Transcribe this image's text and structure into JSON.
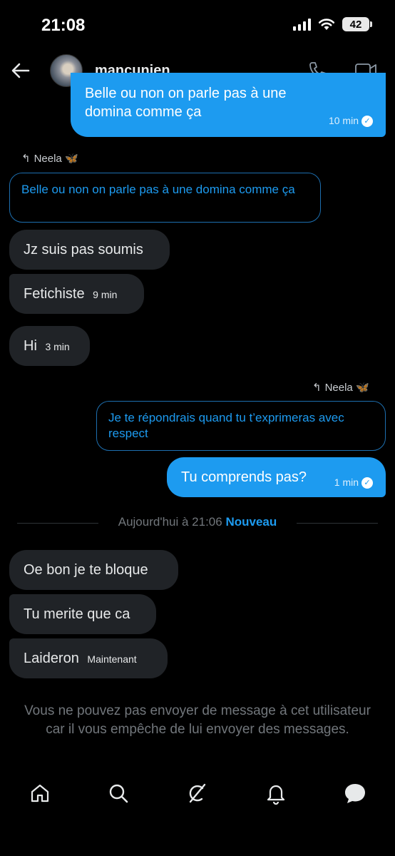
{
  "status": {
    "time": "21:08",
    "battery": "42"
  },
  "header": {
    "username": "mancunien"
  },
  "messages": {
    "top_sent": {
      "text": "Belle ou non on parle pas à une domina comme ça",
      "time": "10 min"
    },
    "reply1": {
      "label": "Neela 🦋",
      "quote": "Belle ou non on parle pas à une domina comme ça"
    },
    "recv1": {
      "text": "Jz suis pas soumis"
    },
    "recv2": {
      "text": "Fetichiste",
      "time": "9 min"
    },
    "recv3": {
      "text": "Hi",
      "time": "3 min"
    },
    "reply2": {
      "label": "Neela 🦋",
      "quote": "Je te répondrais quand tu t’exprimeras avec respect"
    },
    "sent2": {
      "text": "Tu comprends pas?",
      "time": "1 min"
    },
    "divider": {
      "text": "Aujourd'hui à 21:06",
      "new_label": "Nouveau"
    },
    "recv4": {
      "text": "Oe bon je te bloque"
    },
    "recv5": {
      "text": "Tu merite que ca"
    },
    "recv6": {
      "text": "Laideron",
      "time": "Maintenant"
    }
  },
  "blocked_notice": "Vous ne pouvez pas envoyer de message à cet utilisateur car il vous empêche de lui envoyer des messages.",
  "nav": [
    "home-icon",
    "search-icon",
    "grok-icon",
    "notifications-icon",
    "messages-icon"
  ],
  "colors": {
    "accent": "#1d9bf0",
    "received_bubble": "#202327",
    "background": "#000000",
    "muted": "#71767b"
  }
}
